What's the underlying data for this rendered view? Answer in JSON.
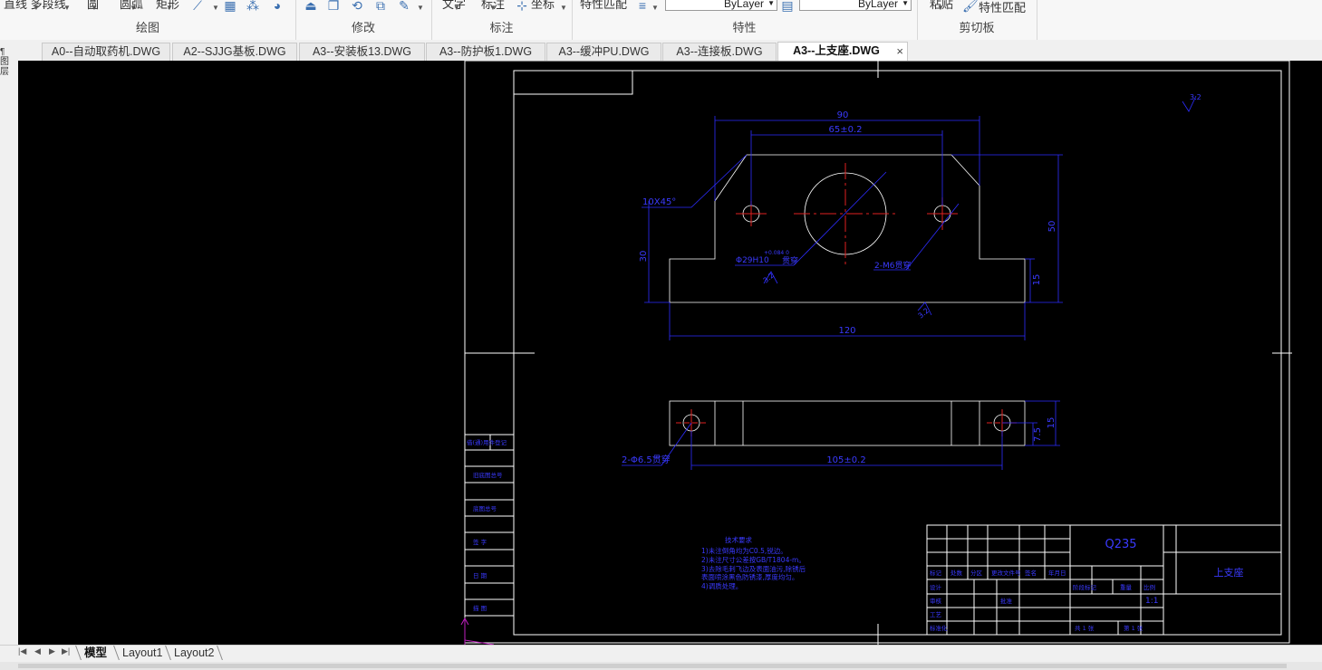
{
  "ribbon": {
    "cut_left": "直线 多段线",
    "draw_group_top_a": "圆",
    "draw_group_top_b": "圆弧",
    "draw_group_top_c": "矩形",
    "draw_label": "绘图",
    "modify_label": "修改",
    "annotate_top_a": "文字",
    "annotate_top_b": "标注",
    "coord_label": "坐标",
    "annotate_label": "标注",
    "properties_top": "特性匹配",
    "bylayer_color": "ByLayer",
    "bylayer_linetype": "ByLayer",
    "properties_label": "特性",
    "clipboard_paste": "粘贴",
    "match_props": "特性匹配",
    "clipboard_label": "剪切板"
  },
  "tabs": [
    {
      "label": "A0--自动取药机.DWG",
      "active": false
    },
    {
      "label": "A2--SJJG基板.DWG",
      "active": false
    },
    {
      "label": "A3--安装板13.DWG",
      "active": false
    },
    {
      "label": "A3--防护板1.DWG",
      "active": false
    },
    {
      "label": "A3--缓冲PU.DWG",
      "active": false
    },
    {
      "label": "A3--连接板.DWG",
      "active": false
    },
    {
      "label": "A3--上支座.DWG",
      "active": true
    }
  ],
  "tab_close": "×",
  "left_dock": [
    "¶",
    "图",
    "层"
  ],
  "drawing": {
    "dim_90": "90",
    "dim_65": "65±0.2",
    "dim_chamfer": "10X45°",
    "dim_50": "50",
    "dim_30": "30",
    "dim_15_right": "15",
    "dim_hole": "Φ29H10",
    "dim_tol": "+0.084\n0",
    "dim_thru": "贯穿",
    "dim_2m": "2-M6贯穿",
    "dim_120": "120",
    "dim_105": "105±0.2",
    "dim_15_side": "15",
    "dim_75": "7.5",
    "dim_2holes": "2-Φ6.5贯穿",
    "roughness_top": "3.2",
    "roughness_a": "3.2",
    "roughness_b": "3.2",
    "material": "Q235",
    "part_name": "上支座",
    "notes_title": "技术要求",
    "notes": [
      "1)未注倒角均为C0.5,锐边。",
      "2)未注尺寸公差按GB/T1804-m。",
      "3)去除毛刺飞边及表面油污,除锈后",
      "   表面喷涂黑色防锈漆,厚度均匀。",
      "4)调质处理。"
    ],
    "left_strip_labels": [
      "借(通)用件登记",
      "旧底图总号",
      "底图总号",
      "签 字",
      "日 期",
      "描 图",
      "描 校"
    ],
    "title_block_small": [
      "标记",
      "处数",
      "分区",
      "更改文件号",
      "签名",
      "年月日",
      "设计",
      "审核",
      "工艺",
      "标准化",
      "批准",
      "阶段标记",
      "重量",
      "比例",
      "共 1 张",
      "第 1 张",
      "1:1"
    ]
  },
  "layout_tabs": [
    {
      "label": "模型",
      "active": true
    },
    {
      "label": "Layout1",
      "active": false
    },
    {
      "label": "Layout2",
      "active": false
    }
  ],
  "nav_buttons": [
    "|◀",
    "◀",
    "▶",
    "▶|"
  ]
}
